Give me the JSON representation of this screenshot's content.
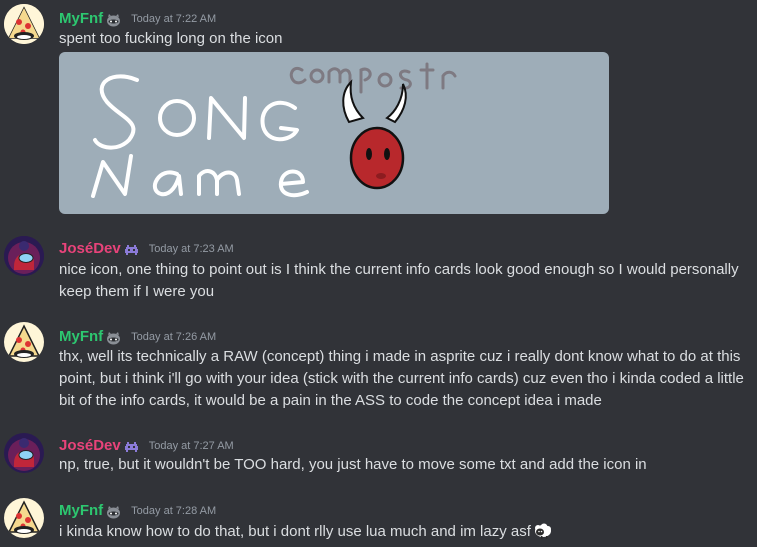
{
  "messages": [
    {
      "username": "MyFnf",
      "timestamp": "Today at 7:22 AM",
      "text": "spent too fucking long on the icon",
      "badge_icon": "raccoon-icon"
    },
    {
      "username": "JoséDev",
      "timestamp": "Today at 7:23 AM",
      "text": "nice icon, one thing to point out is I think the current info cards look good enough so I would personally keep them if I were you",
      "badge_icon": "space-invader-icon"
    },
    {
      "username": "MyFnf",
      "timestamp": "Today at 7:26 AM",
      "text": "thx, well its technically a RAW (concept) thing i made in asprite cuz i really dont know what to do at this point, but i think i'll go with your idea (stick with the current info cards) cuz even tho i kinda coded a little bit of the info cards, it would be a pain in the ASS to code the concept idea i made",
      "badge_icon": "raccoon-icon"
    },
    {
      "username": "JoséDev",
      "timestamp": "Today at 7:27 AM",
      "text": "np, true, but it wouldn't be TOO hard, you just have to move some txt and add the icon in",
      "badge_icon": "space-invader-icon"
    },
    {
      "username": "MyFnf",
      "timestamp": "Today at 7:28 AM",
      "text": "i kinda know how to do that, but i dont rlly use lua much and im lazy asf",
      "badge_icon": "raccoon-icon",
      "trailing_emoji": "sheep-emoji"
    }
  ],
  "attachment": {
    "song_word": "SONG",
    "name_word": "Name",
    "composer_word": "composer",
    "background": "#9eadb8"
  },
  "colors": {
    "background": "#313338",
    "myfnf": "#2dc770",
    "jose": "#e8437a",
    "timestamp": "#949ba4",
    "text": "#dbdee1"
  }
}
